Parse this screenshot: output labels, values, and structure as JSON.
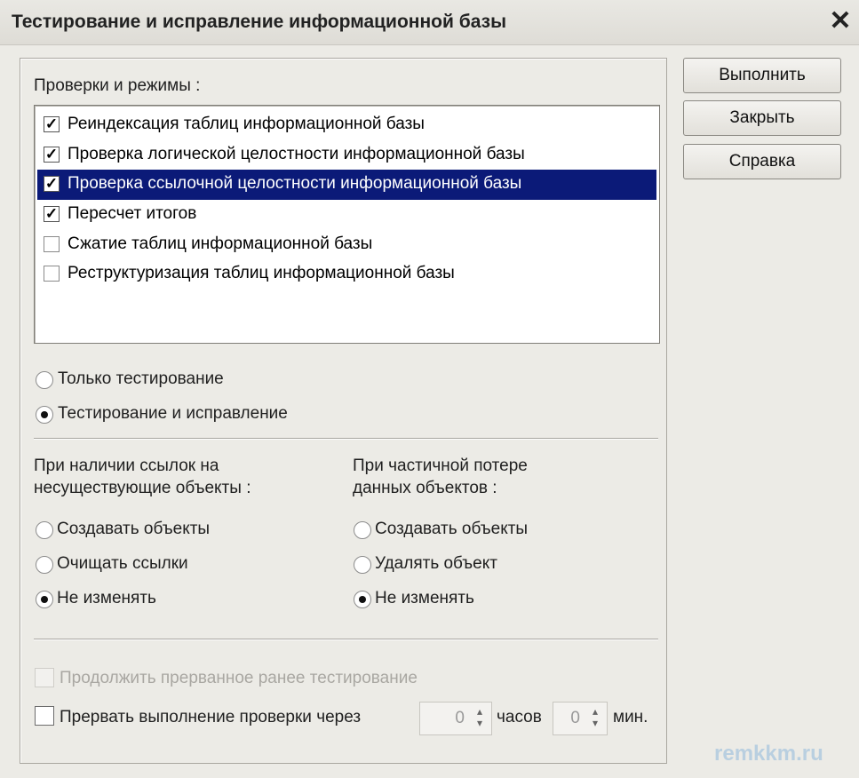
{
  "window": {
    "title": "Тестирование и исправление информационной базы",
    "close_icon": "close-icon"
  },
  "checks": {
    "label": "Проверки и режимы :",
    "items": [
      {
        "label": "Реиндексация таблиц информационной базы",
        "checked": true,
        "selected": false
      },
      {
        "label": "Проверка логической целостности информационной базы",
        "checked": true,
        "selected": false
      },
      {
        "label": "Проверка ссылочной целостности информационной базы",
        "checked": true,
        "selected": true
      },
      {
        "label": "Пересчет итогов",
        "checked": true,
        "selected": false
      },
      {
        "label": "Сжатие таблиц информационной базы",
        "checked": false,
        "selected": false
      },
      {
        "label": "Реструктуризация таблиц информационной базы",
        "checked": false,
        "selected": false
      }
    ]
  },
  "mode": {
    "options": [
      {
        "label": "Только тестирование",
        "selected": false
      },
      {
        "label": "Тестирование и исправление",
        "selected": true
      }
    ]
  },
  "missing_refs": {
    "title": "При наличии ссылок на\nнесуществующие объекты :",
    "title_line1": "При наличии ссылок на",
    "title_line2": "несуществующие объекты :",
    "options": [
      {
        "label": "Создавать объекты",
        "selected": false
      },
      {
        "label": "Очищать ссылки",
        "selected": false
      },
      {
        "label": "Не изменять",
        "selected": true
      }
    ]
  },
  "partial_loss": {
    "title_line1": "При частичной потере",
    "title_line2": "данных объектов :",
    "options": [
      {
        "label": "Создавать объекты",
        "selected": false
      },
      {
        "label": "Удалять объект",
        "selected": false
      },
      {
        "label": "Не изменять",
        "selected": true
      }
    ]
  },
  "continue_testing": {
    "label": "Продолжить прерванное ранее тестирование",
    "checked": false,
    "enabled": false
  },
  "interrupt": {
    "label": "Прервать выполнение проверки через",
    "checked": false,
    "hours_value": "0",
    "hours_unit": "часов",
    "minutes_value": "0",
    "minutes_unit": "мин."
  },
  "buttons": {
    "run": "Выполнить",
    "close": "Закрыть",
    "help": "Справка"
  },
  "watermark": "remkkm.ru",
  "colors": {
    "selection": "#0b1a78",
    "dialog_bg": "#ecebe6"
  }
}
